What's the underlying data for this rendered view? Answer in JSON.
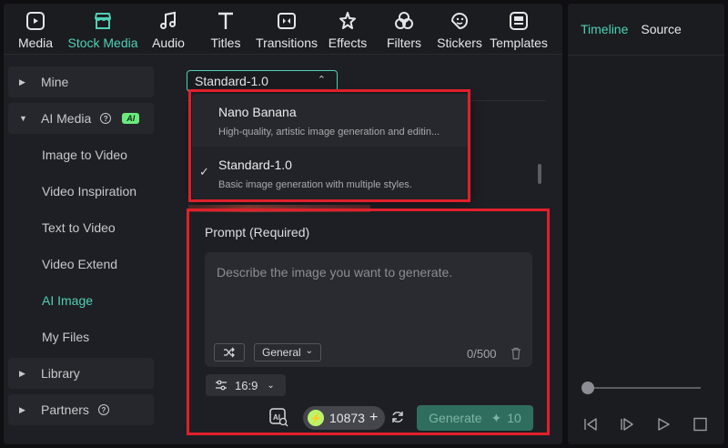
{
  "toolbar": {
    "items": [
      {
        "label": "Media",
        "icon": "media-icon",
        "active": false
      },
      {
        "label": "Stock Media",
        "icon": "stock-media-icon",
        "active": true
      },
      {
        "label": "Audio",
        "icon": "music-note-icon",
        "active": false
      },
      {
        "label": "Titles",
        "icon": "text-t-icon",
        "active": false
      },
      {
        "label": "Transitions",
        "icon": "transitions-icon",
        "active": false
      },
      {
        "label": "Effects",
        "icon": "effects-star-icon",
        "active": false
      },
      {
        "label": "Filters",
        "icon": "filters-icon",
        "active": false
      },
      {
        "label": "Stickers",
        "icon": "sticker-icon",
        "active": false
      },
      {
        "label": "Templates",
        "icon": "templates-icon",
        "active": false
      }
    ]
  },
  "sidebar": {
    "mine": "Mine",
    "ai_media": "AI Media",
    "ai_badge": "AI",
    "sub_items": [
      "Image to Video",
      "Video Inspiration",
      "Text to Video",
      "Video Extend",
      "AI Image",
      "My Files"
    ],
    "active_sub": "AI Image",
    "library": "Library",
    "partners": "Partners"
  },
  "model_select": {
    "value": "Standard-1.0"
  },
  "dropdown": {
    "options": [
      {
        "title": "Nano Banana",
        "desc": "High-quality, artistic image generation and editin...",
        "selected": false
      },
      {
        "title": "Standard-1.0",
        "desc": "Basic image generation with multiple styles.",
        "selected": true
      }
    ]
  },
  "prompt": {
    "label": "Prompt (Required)",
    "placeholder": "Describe the image you want to generate.",
    "style_value": "General",
    "char_count": "0/500",
    "ratio": "16:9"
  },
  "credits": {
    "value": "10873"
  },
  "generate": {
    "label": "Generate",
    "cost": "10"
  },
  "right_panel": {
    "tabs": [
      "Timeline",
      "Source"
    ],
    "active_tab": "Timeline"
  },
  "colors": {
    "accent": "#4fd1b5",
    "highlight_box": "#e0202a",
    "ai_badge": "#6bea7b"
  }
}
